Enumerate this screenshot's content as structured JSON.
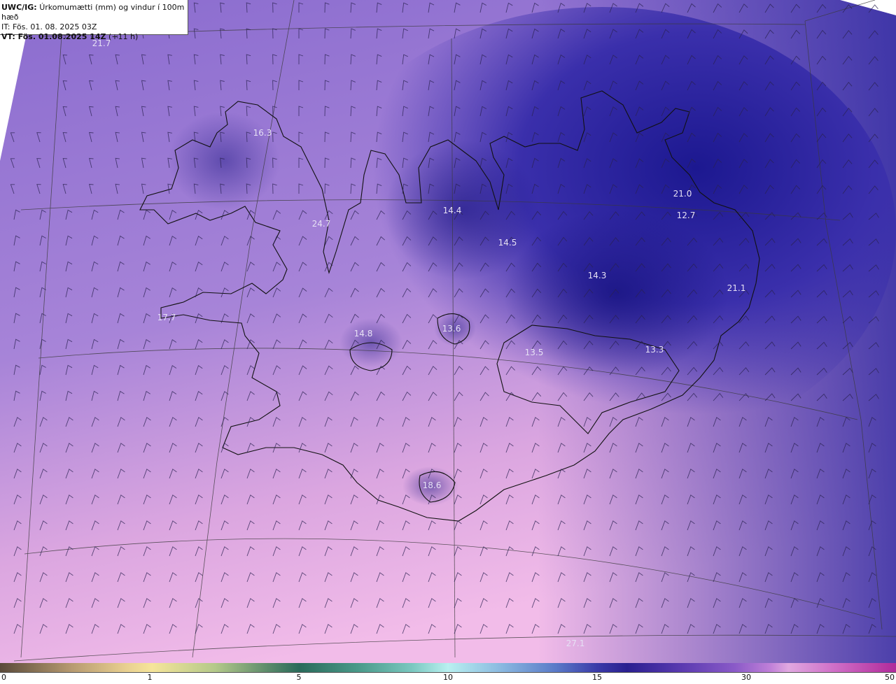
{
  "header": {
    "model": "UWC/IG:",
    "title": "Úrkomumætti (mm) og vindur í 100m hæð",
    "init_time": "IT: Fös. 01. 08. 2025 03Z",
    "valid_label": "VT: Fös. 01.08.2025 14Z",
    "valid_offset": "(+11 h)"
  },
  "colors": {
    "background_low": "#f0b8e6",
    "background_mid": "#9a78d8",
    "background_high": "#2a209a",
    "coastline": "#111111",
    "gridline": "#3a3a3a"
  },
  "map_labels": [
    {
      "text": "21.7",
      "id": "nw-sea"
    },
    {
      "text": "16.3",
      "id": "westfjords"
    },
    {
      "text": "24.7",
      "id": "hunafloi"
    },
    {
      "text": "14.4",
      "id": "trollaskagi"
    },
    {
      "text": "14.5",
      "id": "eyjafjordur"
    },
    {
      "text": "14.3",
      "id": "northeast-interior"
    },
    {
      "text": "21.0",
      "id": "vopnafjordur"
    },
    {
      "text": "12.7",
      "id": "east-highlands"
    },
    {
      "text": "21.1",
      "id": "eastfjords"
    },
    {
      "text": "17.7",
      "id": "snaefellsnes"
    },
    {
      "text": "14.8",
      "id": "west-interior"
    },
    {
      "text": "13.6",
      "id": "hofsjokull"
    },
    {
      "text": "13.5",
      "id": "vatnajokull-west"
    },
    {
      "text": "13.3",
      "id": "vatnajokull-east"
    },
    {
      "text": "18.6",
      "id": "myrdalsjokull"
    },
    {
      "text": "27.1",
      "id": "south-sea"
    }
  ],
  "colorbar": {
    "ticks": [
      "0",
      "1",
      "5",
      "10",
      "15",
      "30",
      "50"
    ]
  }
}
